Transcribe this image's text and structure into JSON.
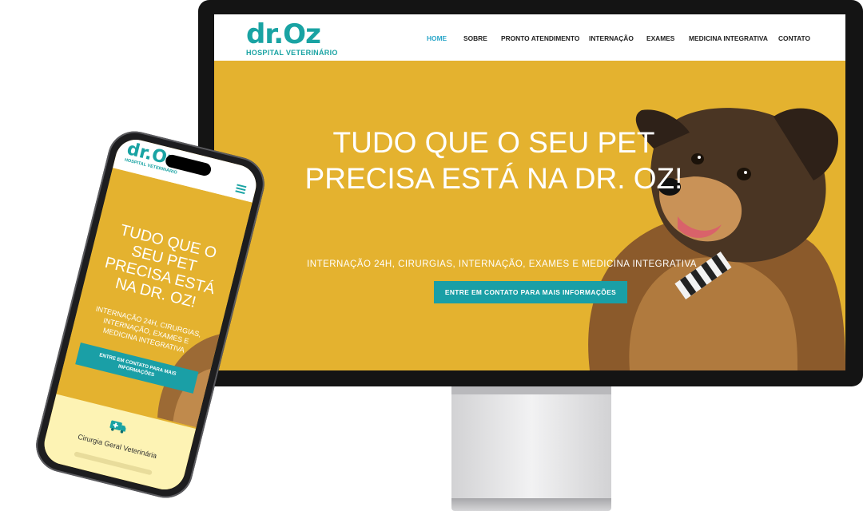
{
  "brand": {
    "name": "dr.Oz",
    "subtitle": "HOSPITAL VETERINÁRIO",
    "color": "#19a3a3",
    "accent_bg": "#e4b22f"
  },
  "desktop": {
    "nav": {
      "items": [
        {
          "label": "HOME",
          "active": true
        },
        {
          "label": "SOBRE"
        },
        {
          "label": "PRONTO ATENDIMENTO"
        },
        {
          "label": "INTERNAÇÃO"
        },
        {
          "label": "EXAMES"
        },
        {
          "label": "MEDICINA INTEGRATIVA"
        },
        {
          "label": "CONTATO"
        }
      ]
    },
    "hero": {
      "title_line1": "TUDO QUE O SEU PET",
      "title_line2": "PRECISA ESTÁ NA DR. OZ!",
      "subtitle": "INTERNAÇÃO 24H, CIRURGIAS, INTERNAÇÃO, EXAMES E MEDICINA INTEGRATIVA",
      "cta": "ENTRE EM CONTATO PARA MAIS INFORMAÇÕES"
    }
  },
  "mobile": {
    "hero": {
      "title_lines": [
        "TUDO QUE O",
        "SEU PET",
        "PRECISA ESTÁ",
        "NA DR. OZ!"
      ],
      "subtitle_lines": [
        "INTERNAÇÃO 24H, CIRURGIAS,",
        "INTERNAÇÃO, EXAMES E",
        "MEDICINA INTEGRATIVA"
      ],
      "cta_lines": [
        "ENTRE EM CONTATO PARA MAIS",
        "INFORMAÇÕES"
      ]
    },
    "service": {
      "icon": "ambulance-icon",
      "label": "Cirurgia Geral Veterinária"
    }
  }
}
